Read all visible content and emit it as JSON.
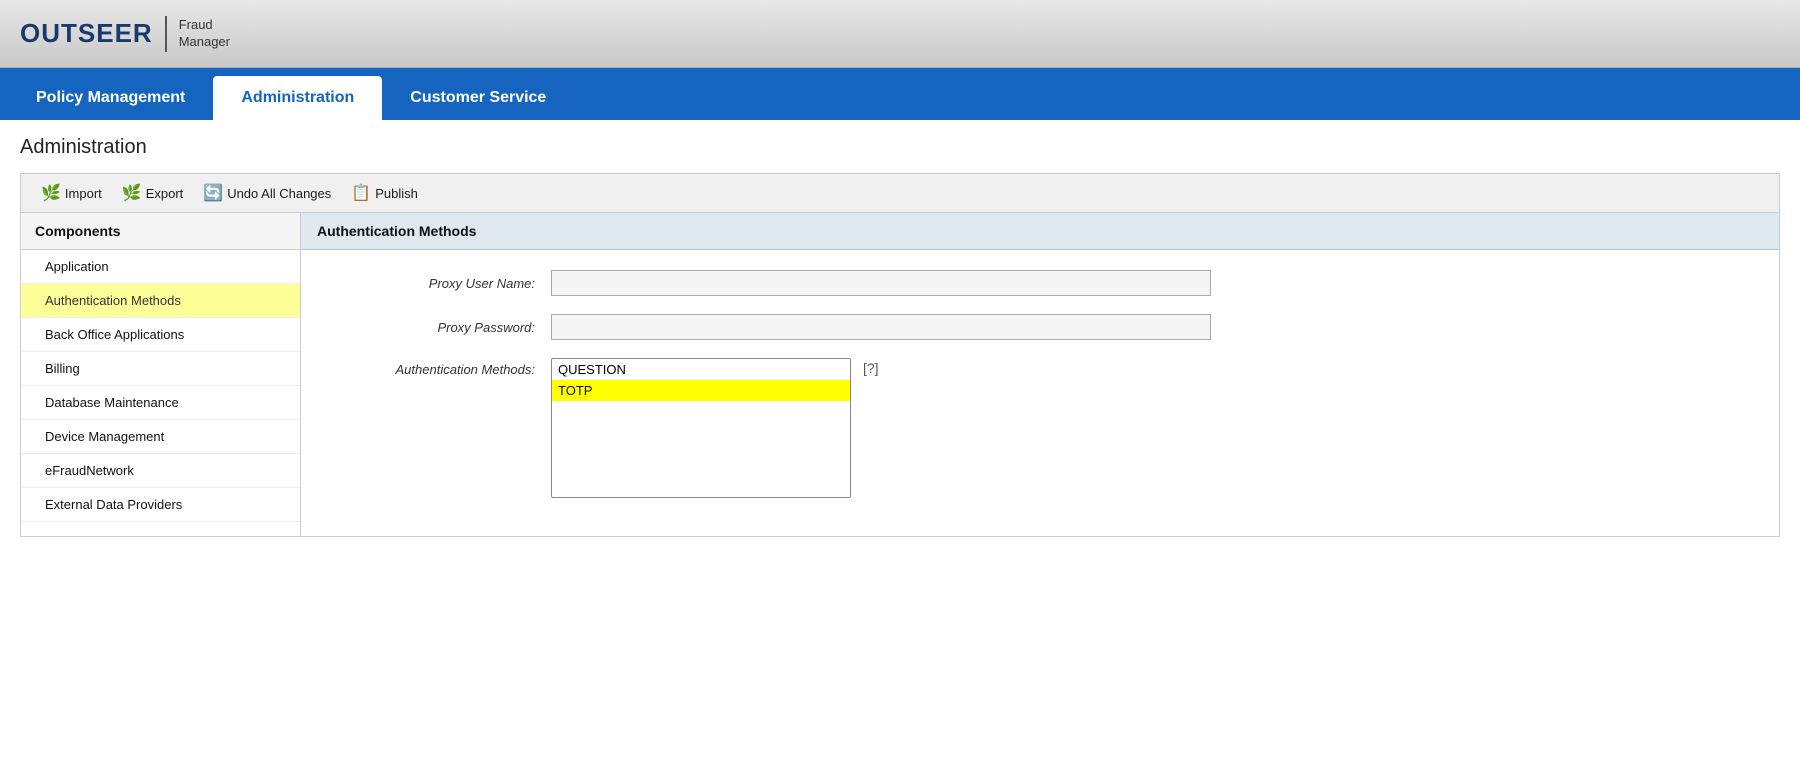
{
  "header": {
    "logo_main": "OUTSEER",
    "logo_sub_line1": "Fraud",
    "logo_sub_line2": "Manager"
  },
  "nav": {
    "tabs": [
      {
        "id": "policy",
        "label": "Policy Management",
        "active": false
      },
      {
        "id": "admin",
        "label": "Administration",
        "active": true
      },
      {
        "id": "customer",
        "label": "Customer Service",
        "active": false
      }
    ]
  },
  "page": {
    "title": "Administration"
  },
  "toolbar": {
    "import_label": "Import",
    "export_label": "Export",
    "undo_label": "Undo All Changes",
    "publish_label": "Publish"
  },
  "sidebar": {
    "header": "Components",
    "items": [
      {
        "id": "application",
        "label": "Application",
        "active": false
      },
      {
        "id": "auth-methods",
        "label": "Authentication Methods",
        "active": true
      },
      {
        "id": "back-office",
        "label": "Back Office Applications",
        "active": false
      },
      {
        "id": "billing",
        "label": "Billing",
        "active": false
      },
      {
        "id": "db-maintenance",
        "label": "Database Maintenance",
        "active": false
      },
      {
        "id": "device-management",
        "label": "Device Management",
        "active": false
      },
      {
        "id": "efraud",
        "label": "eFraudNetwork",
        "active": false
      },
      {
        "id": "external-data",
        "label": "External Data Providers",
        "active": false
      }
    ]
  },
  "right_panel": {
    "title": "Authentication Methods",
    "fields": [
      {
        "id": "proxy-user",
        "label": "Proxy User Name:",
        "type": "input",
        "value": ""
      },
      {
        "id": "proxy-pass",
        "label": "Proxy Password:",
        "type": "input",
        "value": ""
      },
      {
        "id": "auth-methods",
        "label": "Authentication Methods:",
        "type": "listbox",
        "options": [
          {
            "value": "QUESTION",
            "highlighted": false
          },
          {
            "value": "TOTP",
            "highlighted": true
          }
        ]
      }
    ],
    "help_tooltip": "[?]"
  }
}
